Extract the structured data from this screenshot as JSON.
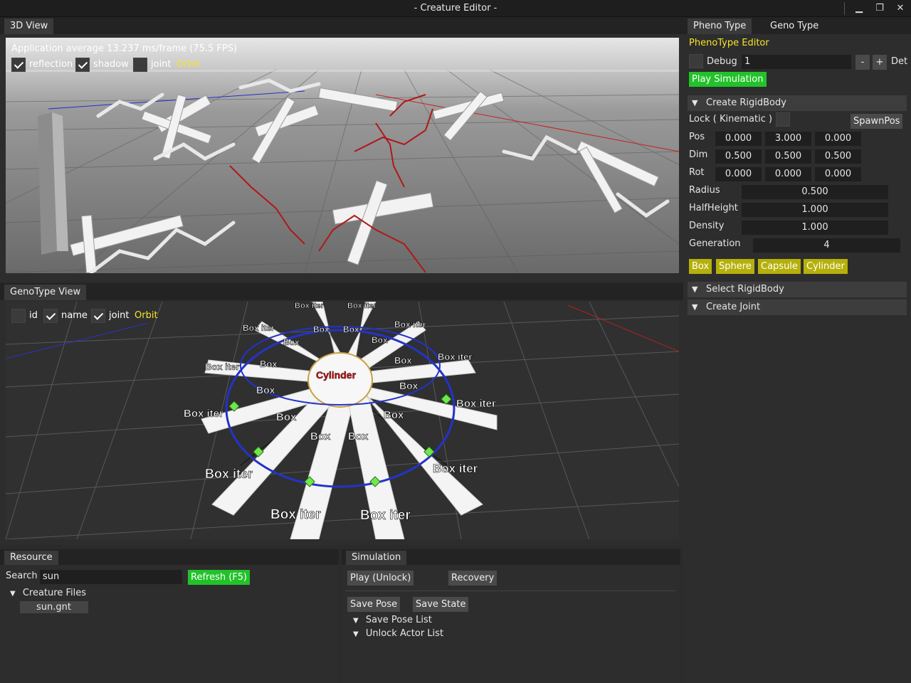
{
  "window": {
    "title": "- Creature Editor -",
    "minimize": "▁",
    "maximize": "❐",
    "close": "✕"
  },
  "view3d": {
    "tab": "3D View",
    "fps_text": "Application average 13.237 ms/frame (75.5 FPS)",
    "reflection_label": "reflection",
    "reflection_checked": true,
    "shadow_label": "shadow",
    "shadow_checked": true,
    "joint_label": "joint",
    "joint_checked": false,
    "orbit_label": "Orbit"
  },
  "genoview": {
    "tab": "GenoType View",
    "id_label": "id",
    "id_checked": false,
    "name_label": "name",
    "name_checked": true,
    "joint_label": "joint",
    "joint_checked": true,
    "orbit_label": "Orbit",
    "center_label": "Cylinder",
    "node_labels": [
      "Box iter",
      "Box iter",
      "Box iter",
      "Box iter",
      "Box iter",
      "Box iter",
      "Box iter",
      "Box iter",
      "Box iter",
      "Box iter",
      "Box iter",
      "Box iter",
      "Box",
      "Box",
      "Box",
      "Box",
      "Box",
      "Box",
      "Box",
      "Box",
      "Box",
      "Box",
      "Box",
      "Box"
    ]
  },
  "right": {
    "tabs": [
      "Pheno Type",
      "Geno Type"
    ],
    "editor_title": "PhenoType Editor",
    "debug_label": "Debug",
    "debug_value": "1",
    "minus": "-",
    "plus": "+",
    "det": "Det",
    "play_sim": "Play Simulation",
    "create_rigidbody": "Create RigidBody",
    "lock_label": "Lock ( Kinematic )",
    "spawnpos": "SpawnPos",
    "pos_label": "Pos",
    "pos": [
      "0.000",
      "3.000",
      "0.000"
    ],
    "dim_label": "Dim",
    "dim": [
      "0.500",
      "0.500",
      "0.500"
    ],
    "rot_label": "Rot",
    "rot": [
      "0.000",
      "0.000",
      "0.000"
    ],
    "radius_label": "Radius",
    "radius": "0.500",
    "halfheight_label": "HalfHeight",
    "halfheight": "1.000",
    "density_label": "Density",
    "density": "1.000",
    "generation_label": "Generation",
    "generation": "4",
    "shape_buttons": [
      "Box",
      "Sphere",
      "Capsule",
      "Cylinder"
    ],
    "select_rigidbody": "Select RigidBody",
    "create_joint": "Create Joint"
  },
  "resource": {
    "tab": "Resource",
    "search_label": "Search",
    "search_value": "sun",
    "refresh": "Refresh (F5)",
    "tree_root": "Creature Files",
    "tree_item": "sun.gnt"
  },
  "simulation": {
    "tab": "Simulation",
    "play": "Play (Unlock)",
    "recovery": "Recovery",
    "save_pose": "Save Pose",
    "save_state": "Save State",
    "save_pose_list": "Save Pose List",
    "unlock_actor_list": "Unlock Actor List"
  },
  "colors": {
    "accent_yellow": "#f5e52a",
    "button_yellow": "#b5b00a",
    "button_green": "#22c22a"
  }
}
